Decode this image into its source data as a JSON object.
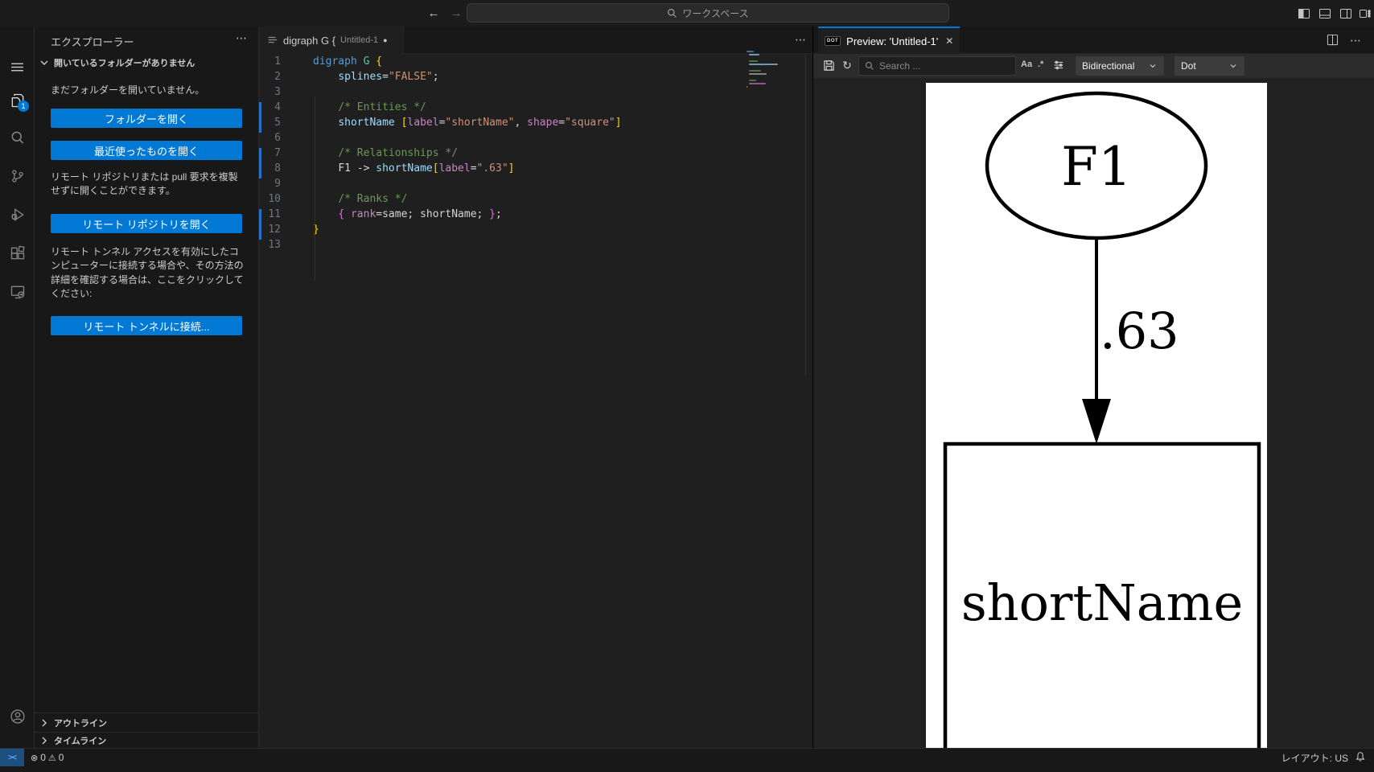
{
  "window": {
    "search_placeholder": "ワークスペース"
  },
  "icons": {
    "back": "←",
    "forward": "→",
    "more": "⋯",
    "close": "✕",
    "modified_dot": "●",
    "refresh": "↻",
    "error": "⊗",
    "warning": "⚠",
    "match_case": "Aa",
    "regex": ".*",
    "remote": "><"
  },
  "activity_bar": {
    "badge": "1",
    "items": [
      "menu",
      "explorer",
      "search",
      "source-control",
      "run-and-debug",
      "extensions",
      "remote-explorer",
      "accounts",
      "settings"
    ]
  },
  "sidebar": {
    "title": "エクスプローラー",
    "section_header": "開いているフォルダーがありません",
    "empty_text": "まだフォルダーを開いていません。",
    "open_folder_button": "フォルダーを開く",
    "open_recent_button": "最近使ったものを開く",
    "remote_repo_text": "リモート リポジトリまたは pull 要求を複製せずに開くことができます。",
    "open_remote_repo_button": "リモート リポジトリを開く",
    "tunnel_text": "リモート トンネル アクセスを有効にしたコンピューターに接続する場合や、その方法の詳細を確認する場合は、ここをクリックしてください:",
    "connect_tunnel_button": "リモート トンネルに接続...",
    "outline_section": "アウトライン",
    "timeline_section": "タイムライン"
  },
  "editor": {
    "tab_title": "digraph G {",
    "tab_description": "Untitled-1",
    "lines": [
      {
        "n": "1",
        "seg": [
          [
            "digraph",
            "kw"
          ],
          [
            " ",
            "p"
          ],
          [
            "G",
            "type"
          ],
          [
            " ",
            "p"
          ],
          [
            "{",
            "b1"
          ]
        ]
      },
      {
        "n": "2",
        "seg": [
          [
            "    ",
            "p"
          ],
          [
            "splines",
            "attr"
          ],
          [
            "=",
            "p"
          ],
          [
            "\"FALSE\"",
            "str"
          ],
          [
            ";",
            "p"
          ]
        ]
      },
      {
        "n": "3",
        "seg": []
      },
      {
        "n": "4",
        "seg": [
          [
            "    ",
            "p"
          ],
          [
            "/* Entities */",
            "cmt"
          ]
        ]
      },
      {
        "n": "5",
        "seg": [
          [
            "    ",
            "p"
          ],
          [
            "shortName",
            "attr"
          ],
          [
            " ",
            "p"
          ],
          [
            "[",
            "b1"
          ],
          [
            "label",
            "pink"
          ],
          [
            "=",
            "p"
          ],
          [
            "\"shortName\"",
            "str"
          ],
          [
            ",",
            "p"
          ],
          [
            " ",
            "p"
          ],
          [
            "shape",
            "pink"
          ],
          [
            "=",
            "p"
          ],
          [
            "\"square\"",
            "str"
          ],
          [
            "]",
            "b1"
          ]
        ]
      },
      {
        "n": "6",
        "seg": []
      },
      {
        "n": "7",
        "seg": [
          [
            "    ",
            "p"
          ],
          [
            "/* Relationships */",
            "cmt"
          ]
        ]
      },
      {
        "n": "8",
        "seg": [
          [
            "    ",
            "p"
          ],
          [
            "F1",
            "p"
          ],
          [
            " -> ",
            "p"
          ],
          [
            "shortName",
            "attr"
          ],
          [
            "[",
            "b1"
          ],
          [
            "label",
            "pink"
          ],
          [
            "=",
            "p"
          ],
          [
            "\".63\"",
            "str"
          ],
          [
            "]",
            "b1"
          ]
        ]
      },
      {
        "n": "9",
        "seg": []
      },
      {
        "n": "10",
        "seg": [
          [
            "    ",
            "p"
          ],
          [
            "/* Ranks */",
            "cmt"
          ]
        ]
      },
      {
        "n": "11",
        "seg": [
          [
            "    ",
            "p"
          ],
          [
            "{",
            "b2"
          ],
          [
            " ",
            "p"
          ],
          [
            "rank",
            "pink"
          ],
          [
            "=same; ",
            "p"
          ],
          [
            "shortName; ",
            "p"
          ],
          [
            "}",
            "b2"
          ],
          [
            ";",
            "p"
          ]
        ]
      },
      {
        "n": "12",
        "seg": [
          [
            "}",
            "b1"
          ]
        ]
      },
      {
        "n": "13",
        "seg": []
      }
    ]
  },
  "preview": {
    "tab_badge": "DOT",
    "tab_title": "Preview: 'Untitled-1'",
    "toolbar": {
      "search_placeholder": "Search ...",
      "direction_select": "Bidirectional",
      "engine_select": "Dot"
    },
    "graph": {
      "source_node": "F1",
      "edge_label": ".63",
      "target_node": "shortName"
    }
  },
  "status_bar": {
    "error_count": "0",
    "warning_count": "0",
    "layout_label": "レイアウト: US"
  }
}
